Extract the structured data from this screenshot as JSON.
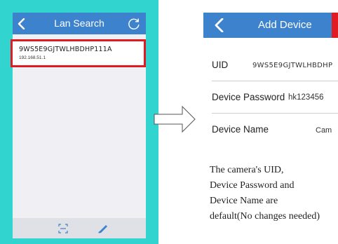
{
  "lan_search": {
    "title": "Lan Search",
    "device": {
      "uid": "9WS5E9GJTWLHBDHP111A",
      "ip": "192.168.51.1"
    },
    "icons": [
      "back-arrow-icon",
      "refresh-icon",
      "add-device-icon",
      "edit-icon"
    ]
  },
  "add_device": {
    "title": "Add Device",
    "fields": [
      {
        "label": "UID",
        "value": "9WS5E9GJTWLHBDHP"
      },
      {
        "label": "Device Password",
        "value": "hk123456"
      },
      {
        "label": "Device Name",
        "value": "Cam"
      }
    ]
  },
  "caption": {
    "lines": [
      "The camera's UID,",
      "Device Password and",
      "Device Name are",
      "default(No changes needed)"
    ]
  },
  "colors": {
    "header_blue": "#3d82cc",
    "highlight_red": "#e21b23",
    "background_cyan": "#31d4cf"
  }
}
